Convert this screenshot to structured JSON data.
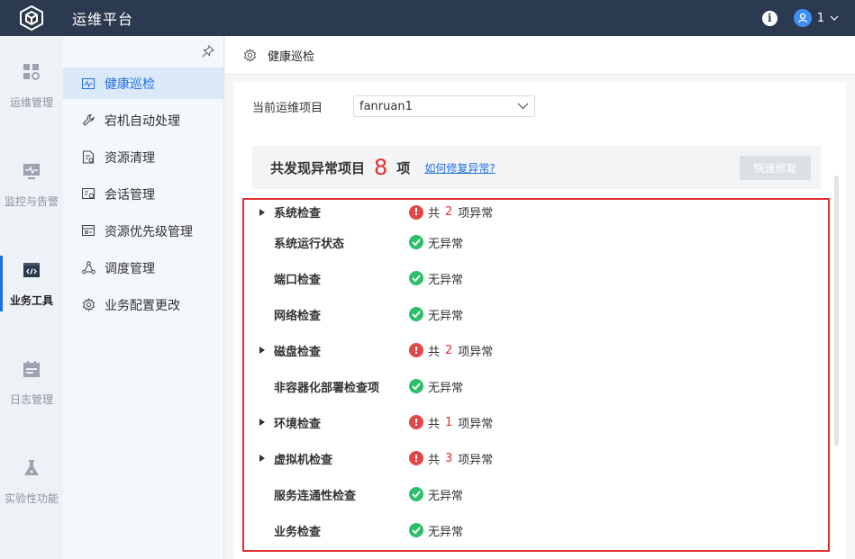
{
  "app": {
    "title": "运维平台"
  },
  "user": {
    "name": "1"
  },
  "rail": [
    {
      "label": "运维管理",
      "icon": "grid-icon"
    },
    {
      "label": "监控与告警",
      "icon": "monitor-icon"
    },
    {
      "label": "业务工具",
      "icon": "code-window-icon",
      "active": true
    },
    {
      "label": "日志管理",
      "icon": "calendar-icon"
    },
    {
      "label": "实验性功能",
      "icon": "flask-icon"
    }
  ],
  "submenu": [
    {
      "label": "健康巡检",
      "icon": "pulse-icon",
      "active": true
    },
    {
      "label": "宕机自动处理",
      "icon": "wrench-icon"
    },
    {
      "label": "资源清理",
      "icon": "document-icon"
    },
    {
      "label": "会话管理",
      "icon": "session-icon"
    },
    {
      "label": "资源优先级管理",
      "icon": "priority-icon"
    },
    {
      "label": "调度管理",
      "icon": "schedule-icon"
    },
    {
      "label": "业务配置更改",
      "icon": "config-gear-icon"
    }
  ],
  "tab": {
    "title": "健康巡检"
  },
  "project": {
    "label": "当前运维项目",
    "value": "fanruan1"
  },
  "summary": {
    "prefix": "共发现异常项目",
    "count": "8",
    "suffix": "项",
    "link": "如何修复异常?",
    "fix_button": "快速修复"
  },
  "checks": [
    {
      "name": "系统检查",
      "expandable": true,
      "status": "error",
      "pre": "共",
      "count": "2",
      "post": "项异常"
    },
    {
      "name": "系统运行状态",
      "expandable": false,
      "status": "ok",
      "text": "无异常"
    },
    {
      "name": "端口检查",
      "expandable": false,
      "status": "ok",
      "text": "无异常"
    },
    {
      "name": "网络检查",
      "expandable": false,
      "status": "ok",
      "text": "无异常"
    },
    {
      "name": "磁盘检查",
      "expandable": true,
      "status": "error",
      "pre": "共",
      "count": "2",
      "post": "项异常"
    },
    {
      "name": "非容器化部署检查项",
      "expandable": false,
      "status": "ok",
      "text": "无异常"
    },
    {
      "name": "环境检查",
      "expandable": true,
      "status": "error",
      "pre": "共",
      "count": "1",
      "post": "项异常"
    },
    {
      "name": "虚拟机检查",
      "expandable": true,
      "status": "error",
      "pre": "共",
      "count": "3",
      "post": "项异常"
    },
    {
      "name": "服务连通性检查",
      "expandable": false,
      "status": "ok",
      "text": "无异常"
    },
    {
      "name": "业务检查",
      "expandable": false,
      "status": "ok",
      "text": "无异常"
    }
  ],
  "colors": {
    "topbar": "#2c3a50",
    "accent": "#1f6fe0",
    "error": "#e03030",
    "ok": "#2fbf6a"
  }
}
